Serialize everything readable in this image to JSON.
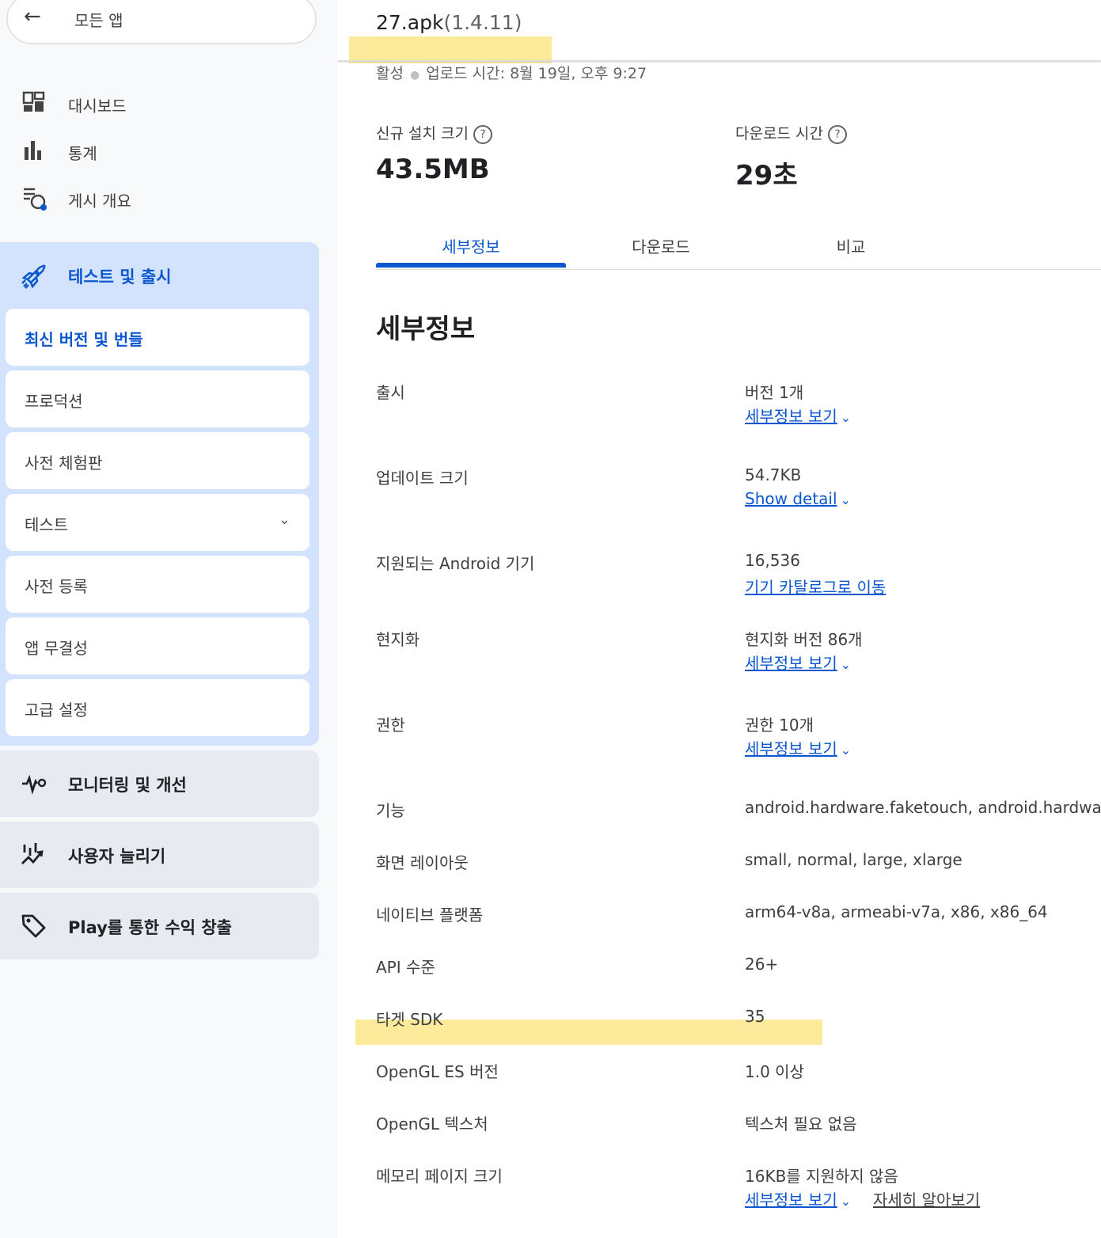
{
  "sidebar": {
    "back_label": "모든 앱",
    "top_items": [
      {
        "label": "대시보드",
        "icon": "dashboard-icon"
      },
      {
        "label": "통계",
        "icon": "bar-chart-icon"
      },
      {
        "label": "게시 개요",
        "icon": "publishing-overview-icon"
      }
    ],
    "release_group": {
      "label": "테스트 및 출시",
      "icon": "rocket-icon",
      "items": [
        {
          "label": "최신 버전 및 번들",
          "active": true
        },
        {
          "label": "프로덕션"
        },
        {
          "label": "사전 체험판"
        },
        {
          "label": "테스트",
          "expandable": true
        },
        {
          "label": "사전 등록"
        },
        {
          "label": "앱 무결성"
        },
        {
          "label": "고급 설정"
        }
      ]
    },
    "sections": [
      {
        "label": "모니터링 및 개선",
        "icon": "pulse-icon"
      },
      {
        "label": "사용자 늘리기",
        "icon": "growth-chart-icon"
      },
      {
        "label": "Play를 통한 수익 창출",
        "icon": "tag-icon"
      }
    ]
  },
  "header": {
    "filename": "27.apk",
    "version": "(1.4.11)",
    "status": "활성",
    "upload_time": "업로드 시간: 8월 19일, 오후 9:27"
  },
  "metrics": [
    {
      "label": "신규 설치 크기",
      "value": "43.5MB"
    },
    {
      "label": "다운로드 시간",
      "value": "29초"
    }
  ],
  "tabs": [
    "세부정보",
    "다운로드",
    "비교"
  ],
  "details": {
    "title": "세부정보",
    "rows": [
      {
        "label": "출시",
        "value": "버전 1개",
        "link": "세부정보 보기"
      },
      {
        "label": "업데이트 크기",
        "value": "54.7KB",
        "link": "Show detail"
      },
      {
        "label": "지원되는 Android 기기",
        "value": "16,536",
        "link": "기기 카탈로그로 이동"
      },
      {
        "label": "현지화",
        "value": "현지화 버전 86개",
        "link": "세부정보 보기"
      },
      {
        "label": "권한",
        "value": "권한 10개",
        "link": "세부정보 보기"
      },
      {
        "label": "기능",
        "value": "android.hardware.faketouch, android.hardware"
      },
      {
        "label": "화면 레이아웃",
        "value": "small, normal, large, xlarge"
      },
      {
        "label": "네이티브 플랫폼",
        "value": "arm64-v8a, armeabi-v7a, x86, x86_64"
      },
      {
        "label": "API 수준",
        "value": "26+"
      },
      {
        "label": "타겟 SDK",
        "value": "35"
      },
      {
        "label": "OpenGL ES 버전",
        "value": "1.0 이상"
      },
      {
        "label": "OpenGL 텍스처",
        "value": "텍스처 필요 없음"
      },
      {
        "label": "메모리 페이지 크기",
        "value": "16KB를 지원하지 않음",
        "link": "세부정보 보기",
        "link2": "자세히 알아보기"
      }
    ]
  },
  "colors": {
    "accent": "#0b57d0",
    "highlight": "#fde68a",
    "nav_active_bg": "#d3e3fd"
  }
}
